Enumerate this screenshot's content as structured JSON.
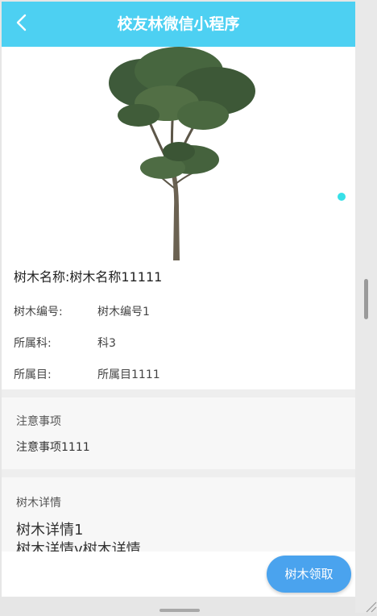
{
  "navbar": {
    "title": "校友林微信小程序",
    "back_icon": "chevron-left-icon"
  },
  "tree": {
    "name_label": "树木名称:",
    "name_value": "树木名称11111",
    "fields": [
      {
        "label": "树木编号:",
        "value": "树木编号1"
      },
      {
        "label": "所属科:",
        "value": "科3"
      },
      {
        "label": "所属目:",
        "value": "所属目1111"
      }
    ]
  },
  "notes": {
    "title": "注意事项",
    "text": "注意事项1111"
  },
  "details": {
    "title": "树木详情",
    "line1": "树木详情1",
    "line2": "树木详情v树木详情"
  },
  "claim_button": {
    "label": "树木领取"
  },
  "colors": {
    "navbar": "#4dd0f2",
    "button": "#4aa3ee",
    "indicator": "#37e0e8"
  }
}
